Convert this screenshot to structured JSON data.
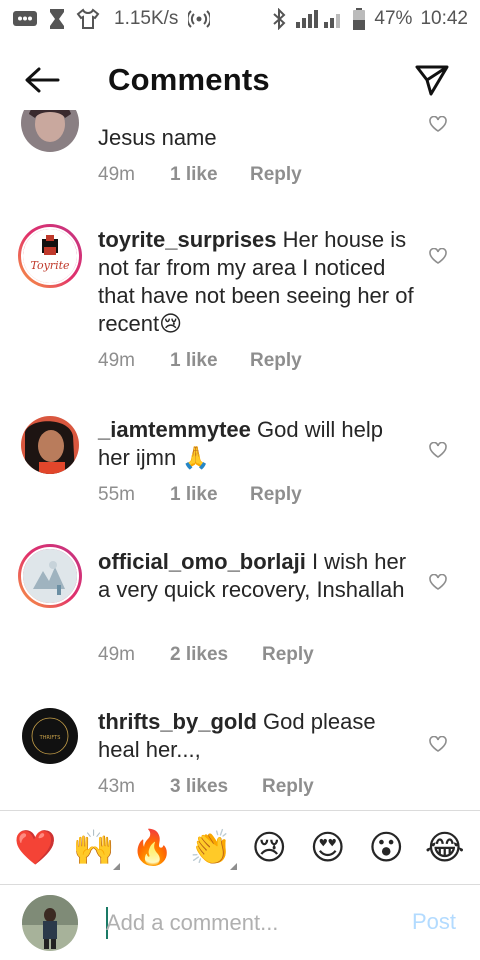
{
  "status_bar": {
    "speed": "1.15K/s",
    "battery": "47%",
    "time": "10:42",
    "icons": [
      "message-icon",
      "hourglass-icon",
      "shirt-icon",
      "hotspot-icon",
      "bluetooth-icon",
      "signal-icon",
      "battery-icon"
    ]
  },
  "header": {
    "title": "Comments"
  },
  "comments": [
    {
      "user": "",
      "text": "Jesus name",
      "time": "49m",
      "likes": "1 like",
      "reply": "Reply"
    },
    {
      "user": "toyrite_surprises",
      "text": "Her house is not far from my area I noticed that have not been seeing her of recent😢",
      "time": "49m",
      "likes": "1 like",
      "reply": "Reply"
    },
    {
      "user": "_iamtemmytee",
      "text": "God will help her ijmn 🙏",
      "time": "55m",
      "likes": "1 like",
      "reply": "Reply"
    },
    {
      "user": "official_omo_borlaji",
      "text": "I wish her a very quick recovery, Inshallah",
      "time": "49m",
      "likes": "2 likes",
      "reply": "Reply"
    },
    {
      "user": "thrifts_by_gold",
      "text": "God please heal her...,",
      "time": "43m",
      "likes": "3 likes",
      "reply": "Reply"
    }
  ],
  "emoji_bar": [
    "❤️",
    "🙌",
    "🔥",
    "👏",
    "😢",
    "😍",
    "😮",
    "😂"
  ],
  "composer": {
    "placeholder": "Add a comment...",
    "post_label": "Post"
  },
  "colors": {
    "post_disabled": "#b3dbff",
    "secondary_text": "#8e8e8e",
    "story_ring": "#e1306c"
  }
}
